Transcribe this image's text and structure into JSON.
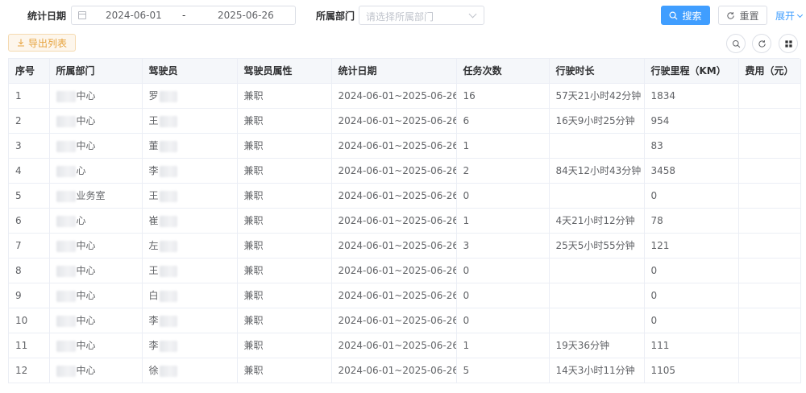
{
  "filters": {
    "date_label": "统计日期",
    "date_start": "2024-06-01",
    "date_sep": "-",
    "date_end": "2025-06-26",
    "dept_label": "所属部门",
    "dept_placeholder": "请选择所属部门",
    "search_label": "搜索",
    "reset_label": "重置",
    "expand_label": "展开"
  },
  "toolbar": {
    "export_label": "导出列表"
  },
  "colors": {
    "primary": "#409eff",
    "warning": "#e6a23c"
  },
  "table": {
    "headers": [
      "序号",
      "所属部门",
      "驾驶员",
      "驾驶员属性",
      "统计日期",
      "任务次数",
      "行驶时长",
      "行驶里程（KM）",
      "费用（元）"
    ],
    "rows": [
      {
        "no": "1",
        "dept": "中心",
        "driver": "罗",
        "attr": "兼职",
        "date": "2024-06-01~2025-06-26",
        "tasks": "16",
        "duration": "57天21小时42分钟",
        "mileage": "1834",
        "fee": ""
      },
      {
        "no": "2",
        "dept": "中心",
        "driver": "王",
        "attr": "兼职",
        "date": "2024-06-01~2025-06-26",
        "tasks": "6",
        "duration": "16天9小时25分钟",
        "mileage": "954",
        "fee": ""
      },
      {
        "no": "3",
        "dept": "中心",
        "driver": "董",
        "attr": "兼职",
        "date": "2024-06-01~2025-06-26",
        "tasks": "1",
        "duration": "",
        "mileage": "83",
        "fee": ""
      },
      {
        "no": "4",
        "dept": "心",
        "driver": "李",
        "attr": "兼职",
        "date": "2024-06-01~2025-06-26",
        "tasks": "2",
        "duration": "84天12小时43分钟",
        "mileage": "3458",
        "fee": ""
      },
      {
        "no": "5",
        "dept": "业务室",
        "driver": "王",
        "attr": "兼职",
        "date": "2024-06-01~2025-06-26",
        "tasks": "0",
        "duration": "",
        "mileage": "0",
        "fee": ""
      },
      {
        "no": "6",
        "dept": "心",
        "driver": "崔",
        "attr": "兼职",
        "date": "2024-06-01~2025-06-26",
        "tasks": "1",
        "duration": "4天21小时12分钟",
        "mileage": "78",
        "fee": ""
      },
      {
        "no": "7",
        "dept": "中心",
        "driver": "左",
        "attr": "兼职",
        "date": "2024-06-01~2025-06-26",
        "tasks": "3",
        "duration": "25天5小时55分钟",
        "mileage": "121",
        "fee": ""
      },
      {
        "no": "8",
        "dept": "中心",
        "driver": "王",
        "attr": "兼职",
        "date": "2024-06-01~2025-06-26",
        "tasks": "0",
        "duration": "",
        "mileage": "0",
        "fee": ""
      },
      {
        "no": "9",
        "dept": "中心",
        "driver": "白",
        "attr": "兼职",
        "date": "2024-06-01~2025-06-26",
        "tasks": "0",
        "duration": "",
        "mileage": "0",
        "fee": ""
      },
      {
        "no": "10",
        "dept": "中心",
        "driver": "李",
        "attr": "兼职",
        "date": "2024-06-01~2025-06-26",
        "tasks": "0",
        "duration": "",
        "mileage": "0",
        "fee": ""
      },
      {
        "no": "11",
        "dept": "中心",
        "driver": "李",
        "attr": "兼职",
        "date": "2024-06-01~2025-06-26",
        "tasks": "1",
        "duration": "19天36分钟",
        "mileage": "111",
        "fee": ""
      },
      {
        "no": "12",
        "dept": "中心",
        "driver": "徐",
        "attr": "兼职",
        "date": "2024-06-01~2025-06-26",
        "tasks": "5",
        "duration": "14天3小时11分钟",
        "mileage": "1105",
        "fee": ""
      }
    ]
  }
}
